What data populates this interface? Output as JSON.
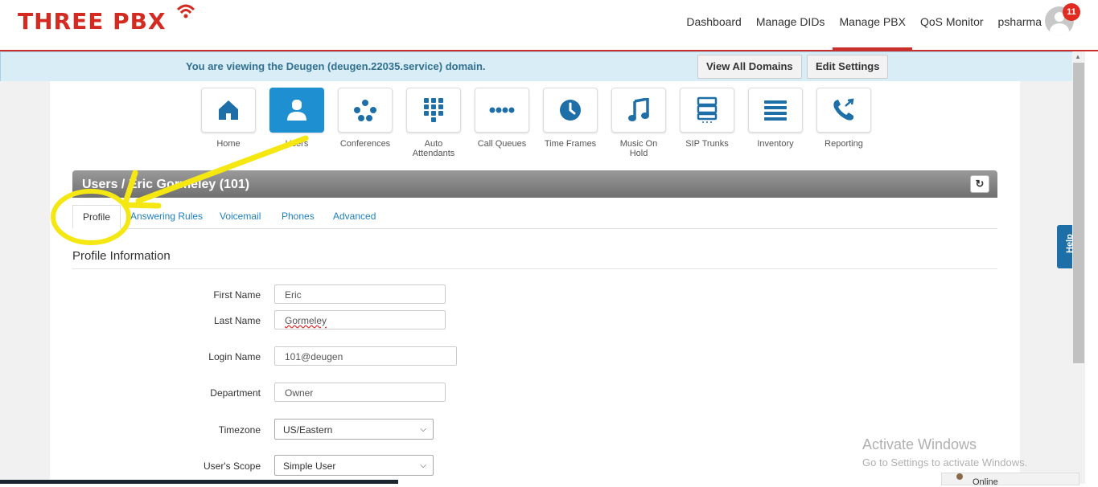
{
  "brand": {
    "logo_text": "THREE PBX",
    "accent_color": "#d32b22"
  },
  "nav": {
    "items": [
      "Dashboard",
      "Manage DIDs",
      "Manage PBX",
      "QoS Monitor",
      "psharma"
    ],
    "active": "Manage PBX",
    "notification_count": "11"
  },
  "banner": {
    "message": "You are viewing the Deugen (deugen.22035.service) domain.",
    "view_all_label": "View All Domains",
    "edit_settings_label": "Edit Settings"
  },
  "tiles": [
    {
      "label": "Home",
      "icon": "home-icon"
    },
    {
      "label": "Users",
      "icon": "user-icon",
      "active": true
    },
    {
      "label": "Conferences",
      "icon": "conference-icon"
    },
    {
      "label": "Auto Attendants",
      "icon": "keypad-icon"
    },
    {
      "label": "Call Queues",
      "icon": "dots-icon"
    },
    {
      "label": "Time Frames",
      "icon": "clock-icon"
    },
    {
      "label": "Music On Hold",
      "icon": "music-icon"
    },
    {
      "label": "SIP Trunks",
      "icon": "server-icon"
    },
    {
      "label": "Inventory",
      "icon": "list-icon"
    },
    {
      "label": "Reporting",
      "icon": "phone-icon"
    }
  ],
  "breadcrumb": {
    "text": "Users / Eric Gormeley (101)"
  },
  "tabs": [
    "Profile",
    "Answering Rules",
    "Voicemail",
    "Phones",
    "Advanced"
  ],
  "section_title": "Profile Information",
  "form": {
    "first_name": {
      "label": "First Name",
      "value": "Eric"
    },
    "last_name": {
      "label": "Last Name",
      "value": "Gormeley"
    },
    "login_name": {
      "label": "Login Name",
      "value": "101@deugen"
    },
    "department": {
      "label": "Department",
      "value": "Owner"
    },
    "timezone": {
      "label": "Timezone",
      "value": "US/Eastern"
    },
    "scope": {
      "label": "User's Scope",
      "value": "Simple User"
    }
  },
  "help_label": "Help",
  "watermark": {
    "line1": "Activate Windows",
    "line2": "Go to Settings to activate Windows."
  },
  "status": {
    "online_label": "Online"
  },
  "annotation_color": "#f5e812"
}
